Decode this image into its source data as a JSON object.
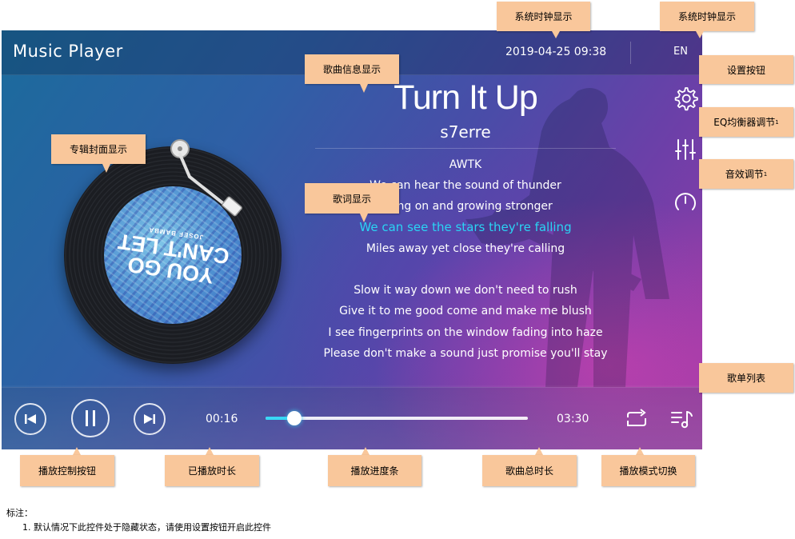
{
  "app": {
    "title": "Music Player",
    "clock": "2019-04-25 09:38",
    "language": "EN"
  },
  "song": {
    "title": "Turn It Up",
    "artist": "s7erre"
  },
  "album": {
    "cover_line1": "YOU GO",
    "cover_line2": "CAN'T LET",
    "cover_line3": "JOSEF BAMBA"
  },
  "lyrics": {
    "lines": [
      "AWTK",
      "We can hear the sound of thunder",
      "Going on and growing stronger",
      "We can see the stars they're falling",
      "Miles away yet close they're calling",
      "",
      "Slow it way down we don't need to rush",
      "Give it to me good come and make me blush",
      "I see fingerprints on the window fading into haze",
      "Please don't make a sound just promise you'll stay"
    ],
    "active_index": 3
  },
  "playback": {
    "elapsed": "00:16",
    "total": "03:30",
    "progress": 0.11
  },
  "icons": {
    "settings": "gear-icon",
    "eq": "equalizer-icon",
    "effects": "dial-icon",
    "prev": "skip-previous-icon",
    "pause": "pause-icon",
    "next": "skip-next-icon",
    "mode": "repeat-icon",
    "playlist": "playlist-icon"
  },
  "colors": {
    "accent": "#2ad4f4",
    "callout": "#f9c79b"
  },
  "annotations": {
    "clock": "系统时钟显示",
    "lang": "系统时钟显示",
    "settings": "设置按钮",
    "eq": "EQ均衡器调节",
    "eq_sup": "1",
    "effects": "音效调节",
    "effects_sup": "1",
    "song_info": "歌曲信息显示",
    "album": "专辑封面显示",
    "lyrics": "歌词显示",
    "playlist": "歌单列表",
    "controls": "播放控制按钮",
    "elapsed": "已播放时长",
    "progress": "播放进度条",
    "total": "歌曲总时长",
    "mode": "播放模式切换"
  },
  "notes": {
    "heading": "标注：",
    "item1": "1. 默认情况下此控件处于隐藏状态，请使用设置按钮开启此控件"
  }
}
